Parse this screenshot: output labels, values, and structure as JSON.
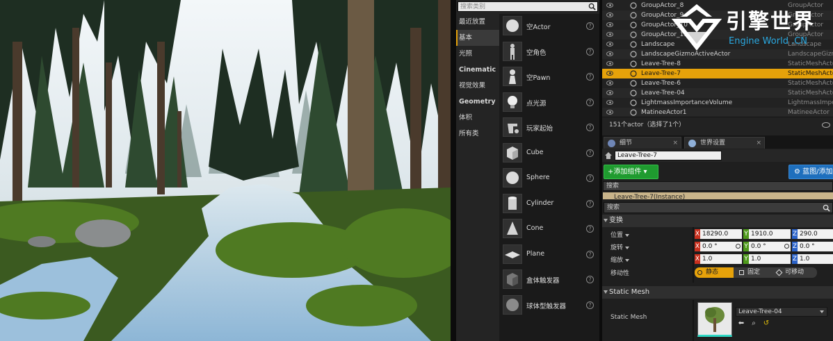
{
  "place": {
    "search_placeholder": "搜索类别",
    "categories": [
      {
        "label": "最近放置",
        "bold": false,
        "active": false
      },
      {
        "label": "基本",
        "bold": false,
        "active": true
      },
      {
        "label": "光照",
        "bold": false,
        "active": false
      },
      {
        "label": "Cinematic",
        "bold": true,
        "active": false
      },
      {
        "label": "视觉效果",
        "bold": false,
        "active": false
      },
      {
        "label": "Geometry",
        "bold": true,
        "active": false
      },
      {
        "label": "体积",
        "bold": false,
        "active": false
      },
      {
        "label": "所有类",
        "bold": false,
        "active": false
      }
    ],
    "items": [
      {
        "label": "空Actor",
        "icon": "sphere-icon"
      },
      {
        "label": "空角色",
        "icon": "character-icon"
      },
      {
        "label": "空Pawn",
        "icon": "pawn-icon"
      },
      {
        "label": "点光源",
        "icon": "lightbulb-icon"
      },
      {
        "label": "玩家起始",
        "icon": "player-start-icon"
      },
      {
        "label": "Cube",
        "icon": "cube-icon"
      },
      {
        "label": "Sphere",
        "icon": "sphere-icon"
      },
      {
        "label": "Cylinder",
        "icon": "cylinder-icon"
      },
      {
        "label": "Cone",
        "icon": "cone-icon"
      },
      {
        "label": "Plane",
        "icon": "plane-icon"
      },
      {
        "label": "盒体触发器",
        "icon": "box-trigger-icon"
      },
      {
        "label": "球体型触发器",
        "icon": "sphere-trigger-icon"
      }
    ],
    "help_glyph": "?"
  },
  "outliner": {
    "rows": [
      {
        "name": "GroupActor_8",
        "type": "GroupActor",
        "icon": "group-icon",
        "selected": false
      },
      {
        "name": "GroupActor_9",
        "type": "GroupActor",
        "icon": "group-icon",
        "selected": false
      },
      {
        "name": "GroupActor_10",
        "type": "GroupActor",
        "icon": "group-icon",
        "selected": false
      },
      {
        "name": "GroupActor_11",
        "type": "GroupActor",
        "icon": "group-icon",
        "selected": false
      },
      {
        "name": "Landscape",
        "type": "Landscape",
        "icon": "landscape-icon",
        "selected": false
      },
      {
        "name": "LandscapeGizmoActiveActor",
        "type": "LandscapeGizmo",
        "icon": "gizmo-icon",
        "selected": false
      },
      {
        "name": "Leave-Tree-8",
        "type": "StaticMeshActor",
        "icon": "static-mesh-icon",
        "selected": false
      },
      {
        "name": "Leave-Tree-7",
        "type": "StaticMeshActor",
        "icon": "static-mesh-icon",
        "selected": true
      },
      {
        "name": "Leave-Tree-6",
        "type": "StaticMeshActor",
        "icon": "static-mesh-icon",
        "selected": false
      },
      {
        "name": "Leave-Tree-04",
        "type": "StaticMeshActor",
        "icon": "static-mesh-icon",
        "selected": false
      },
      {
        "name": "LightmassImportanceVolume",
        "type": "LightmassImpo",
        "icon": "volume-icon",
        "selected": false
      },
      {
        "name": "MatineeActor1",
        "type": "MatineeActor",
        "icon": "matinee-icon",
        "selected": false
      }
    ],
    "status": "151个actor（选择了1个）"
  },
  "logo": {
    "cn": "引擎世界",
    "en": "Engine World .CN"
  },
  "details": {
    "tabs": [
      {
        "label": "细节",
        "icon": "details-icon"
      },
      {
        "label": "世界设置",
        "icon": "world-icon"
      }
    ],
    "tab_close": "×",
    "actor_name": "Leave-Tree-7",
    "add_component": "+添加组件 ▾",
    "blueprint": "蓝图/添加脚本",
    "component_search": "搜索",
    "component_instance": "Leave-Tree-7(Instance)",
    "property_search": "搜索",
    "transform": {
      "section": "变换",
      "location_label": "位置",
      "rotation_label": "旋转",
      "scale_label": "缩放",
      "mobility_label": "移动性",
      "location": [
        "18290.0",
        "1910.0",
        "290.0"
      ],
      "rotation": [
        "0.0 °",
        "0.0 °",
        "0.0 °"
      ],
      "scale": [
        "1.0",
        "1.0",
        "1.0"
      ],
      "axes": [
        "X",
        "Y",
        "Z"
      ],
      "mobility": [
        "静态",
        "固定",
        "可移动"
      ]
    },
    "static_mesh": {
      "section": "Static Mesh",
      "label": "Static Mesh",
      "value": "Leave-Tree-04"
    }
  },
  "colors": {
    "accent": "#e6a20a",
    "add_button": "#1f9b2f",
    "blueprint_button": "#1e6fbd"
  }
}
